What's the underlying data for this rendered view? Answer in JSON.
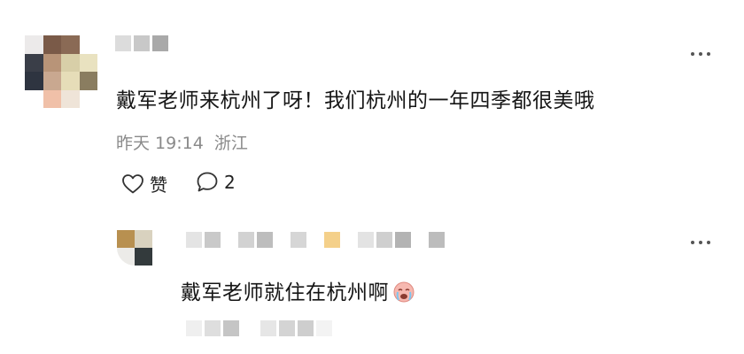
{
  "comment": {
    "text": "戴军老师来杭州了呀！我们杭州的一年四季都很美哦",
    "date": "昨天 19:14",
    "location": "浙江",
    "like_label": "赞",
    "reply_count": "2",
    "more_icon": "more-dots-icon",
    "like_icon": "heart-outline-icon",
    "reply_icon": "speech-bubble-icon"
  },
  "reply": {
    "text": "戴军老师就住在杭州啊",
    "emoji": "crying-face-emoji",
    "more_icon": "more-dots-icon"
  },
  "colors": {
    "meta_gray": "#8a8a8a",
    "text": "#151515"
  }
}
